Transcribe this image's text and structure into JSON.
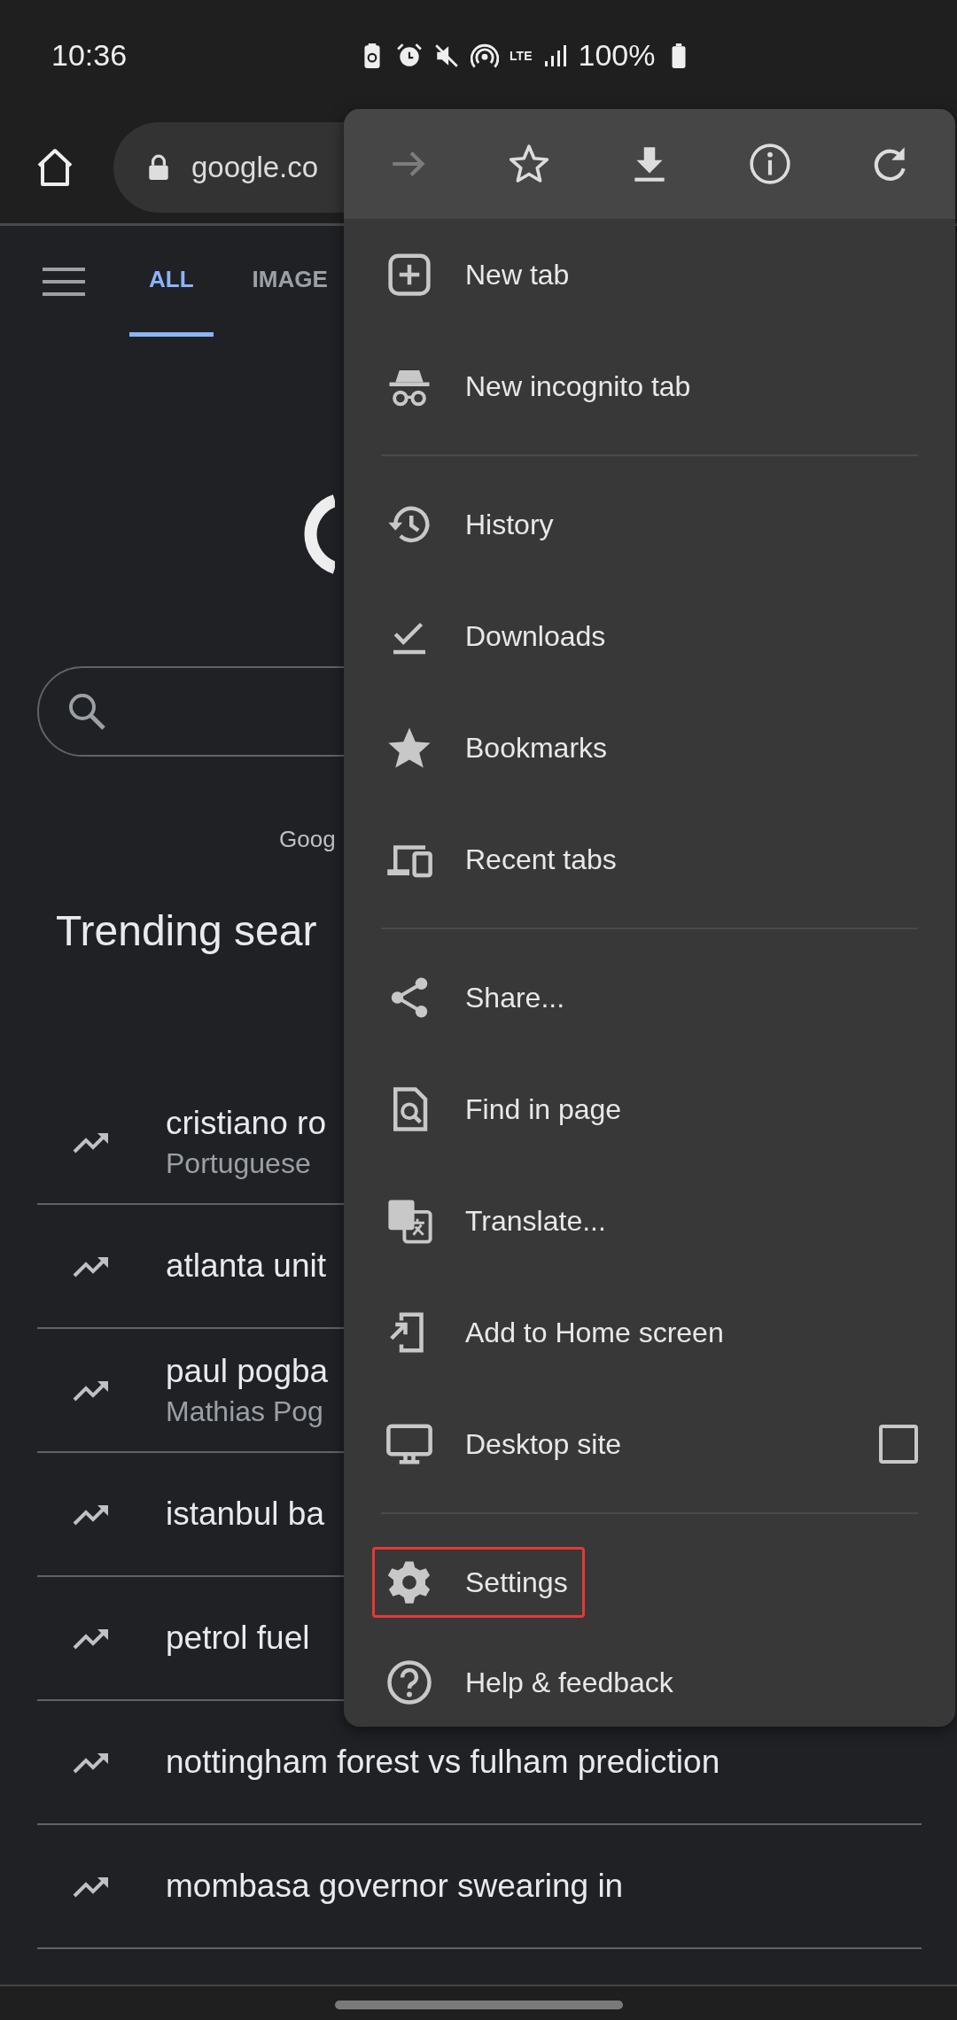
{
  "status_bar": {
    "time": "10:36",
    "network": "LTE",
    "battery": "100%"
  },
  "toolbar": {
    "url": "google.co"
  },
  "tabs": [
    {
      "label": "ALL",
      "selected": true
    },
    {
      "label": "IMAGE",
      "selected": false
    }
  ],
  "page": {
    "footer_text": "Goog",
    "trending_title": "Trending sear"
  },
  "trending": [
    {
      "title": "cristiano ro",
      "subtitle": "Portuguese"
    },
    {
      "title": "atlanta unit"
    },
    {
      "title": "paul pogba",
      "subtitle": "Mathias Pog"
    },
    {
      "title": "istanbul ba"
    },
    {
      "title": "petrol fuel"
    },
    {
      "title": "nottingham forest vs fulham prediction"
    },
    {
      "title": "mombasa governor swearing in"
    }
  ],
  "menu": {
    "actions": [
      {
        "kind": "forward",
        "disabled": true
      },
      {
        "kind": "bookmark",
        "disabled": false
      },
      {
        "kind": "download",
        "disabled": false
      },
      {
        "kind": "info",
        "disabled": false
      },
      {
        "kind": "reload",
        "disabled": false
      }
    ],
    "sections": [
      [
        {
          "kind": "new-tab",
          "label": "New tab",
          "highlighted": false
        },
        {
          "kind": "incognito",
          "label": "New incognito tab",
          "highlighted": false
        }
      ],
      [
        {
          "kind": "history",
          "label": "History",
          "highlighted": false
        },
        {
          "kind": "downloads",
          "label": "Downloads",
          "highlighted": false
        },
        {
          "kind": "bookmarks",
          "label": "Bookmarks",
          "highlighted": false
        },
        {
          "kind": "recent-tabs",
          "label": "Recent tabs",
          "highlighted": false
        }
      ],
      [
        {
          "kind": "share",
          "label": "Share...",
          "highlighted": false
        },
        {
          "kind": "find",
          "label": "Find in page",
          "highlighted": false
        },
        {
          "kind": "translate",
          "label": "Translate...",
          "highlighted": false
        },
        {
          "kind": "add-home",
          "label": "Add to Home screen",
          "highlighted": false
        },
        {
          "kind": "desktop",
          "label": "Desktop site",
          "highlighted": false,
          "checked": false
        }
      ],
      [
        {
          "kind": "settings",
          "label": "Settings",
          "highlighted": true
        },
        {
          "kind": "help",
          "label": "Help & feedback",
          "highlighted": false
        }
      ]
    ]
  }
}
